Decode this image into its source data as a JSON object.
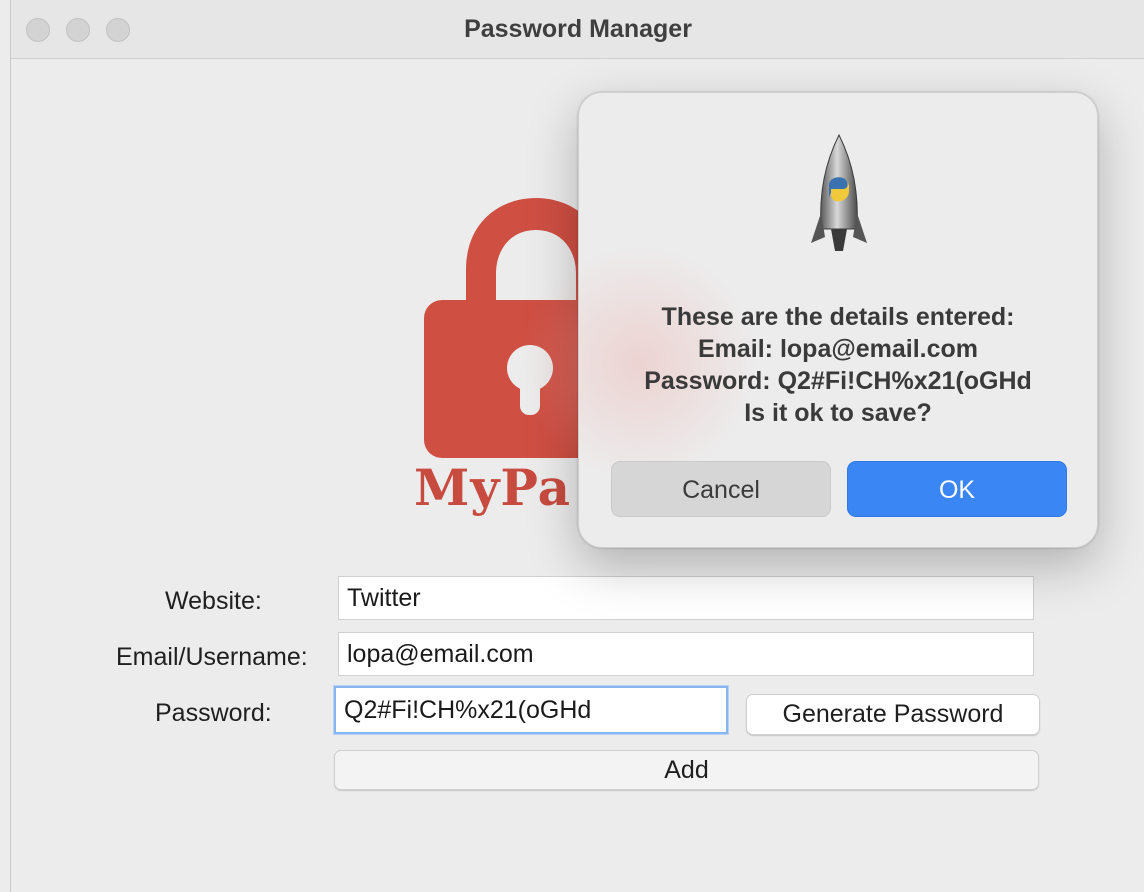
{
  "window": {
    "title": "Password Manager"
  },
  "logo": {
    "text": "MyPa"
  },
  "form": {
    "website_label": "Website:",
    "website_value": "Twitter",
    "email_label": "Email/Username:",
    "email_value": "lopa@email.com",
    "password_label": "Password:",
    "password_value": "Q2#Fi!CH%x21(oGHd",
    "generate_button_label": "Generate Password",
    "add_button_label": "Add"
  },
  "dialog": {
    "icon": "python-launcher-rocket-icon",
    "message_lines": [
      "These are the details entered:",
      "Email: lopa@email.com",
      "Password: Q2#Fi!CH%x21(oGHd",
      "Is it ok to save?"
    ],
    "cancel_label": "Cancel",
    "ok_label": "OK"
  },
  "colors": {
    "accent": "#3a86f5",
    "lock": "#cf4f43"
  }
}
